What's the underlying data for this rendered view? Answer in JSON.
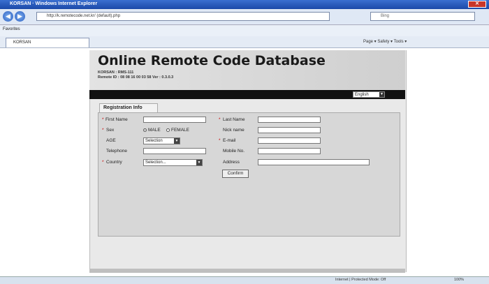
{
  "browser": {
    "window_title": "KORSAN · Windows Internet Explorer",
    "address": "http://k.remotecode.net.kr/ (default).php",
    "search_placeholder": "Bing",
    "favorites_label": "Favorites",
    "tab_label": "KORSAN",
    "toolbar_text": "Page ▾  Safety ▾  Tools ▾",
    "status_zone": "Internet | Protected Mode: Off",
    "zoom": "100%"
  },
  "page": {
    "title": "Online Remote Code Database",
    "line1": "KORSAN : RMS-111",
    "line2": "Remote ID : 08 08 16 00 03 58  Ver : 0.3.0.3",
    "language": "English",
    "section_tab": "Registration Info"
  },
  "form": {
    "first_name_label": "First Name",
    "last_name_label": "Last Name",
    "sex_label": "Sex",
    "male_label": "MALE",
    "female_label": "FEMALE",
    "nick_name_label": "Nick name",
    "age_label": "AGE",
    "age_value": "Selection",
    "email_label": "E-mail",
    "telephone_label": "Telephone",
    "mobile_label": "Mobile No.",
    "country_label": "Country",
    "country_value": "Selection...",
    "address_label": "Address",
    "confirm_label": "Confirm"
  },
  "colors": {
    "required": "#cc0000",
    "header_bar": "#111111"
  }
}
